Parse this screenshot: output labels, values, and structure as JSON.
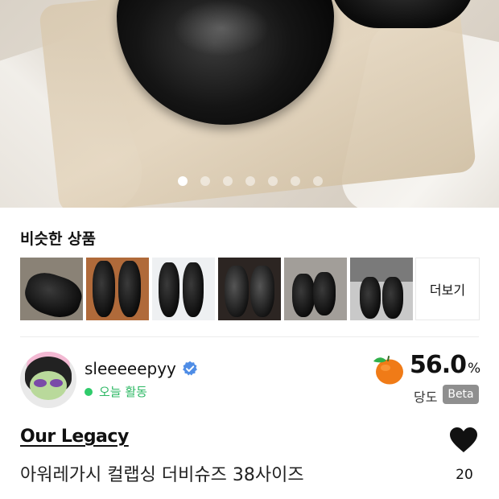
{
  "hero": {
    "page_count": 7,
    "current_page": 1
  },
  "similar": {
    "title": "비슷한 상품",
    "thumbnails": [
      "black-derby-shoe",
      "black-leather-shoe",
      "black-leather-shoe",
      "black-leather-shoe",
      "black-leather-shoe",
      "black-leather-shoe"
    ],
    "more_label": "더보기"
  },
  "seller": {
    "username": "sleeeeepyy",
    "verified_icon": "verified-badge-icon",
    "activity": "오늘 활동",
    "activity_color": "#2fcb6b",
    "temperature_value": "56.0",
    "temperature_unit": "%",
    "temperature_label": "당도",
    "beta_label": "Beta",
    "accent_color": "#f07b17"
  },
  "product": {
    "brand": "Our Legacy",
    "title": "아워레가시 컬랩싱 더비슈즈 38사이즈",
    "like_count": "20"
  }
}
